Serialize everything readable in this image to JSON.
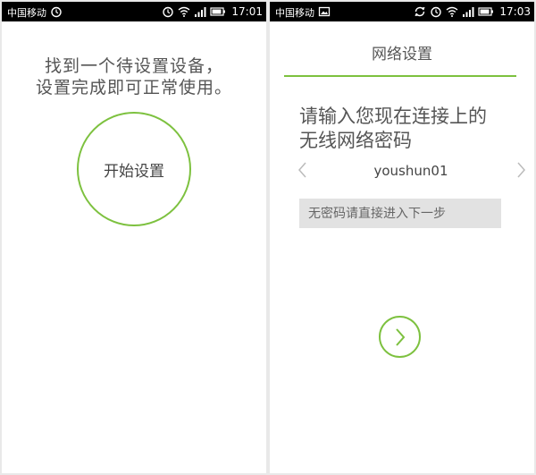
{
  "left_screen": {
    "status_bar": {
      "carrier": "中国移动",
      "time": "17:01",
      "icons": [
        "alarm-icon",
        "alarm-icon",
        "wifi-icon",
        "signal-icon",
        "battery-icon"
      ]
    },
    "intro_line1": "找到一个待设置设备，",
    "intro_line2": "设置完成即可正常使用。",
    "start_button_label": "开始设置"
  },
  "right_screen": {
    "status_bar": {
      "carrier": "中国移动",
      "time": "17:03",
      "icons": [
        "image-icon",
        "sync-icon",
        "alarm-icon",
        "wifi-icon",
        "signal-icon",
        "battery-icon"
      ]
    },
    "title": "网络设置",
    "prompt_line1": "请输入您现在连接上的",
    "prompt_line2": "无线网络密码",
    "ssid": "youshun01",
    "password_placeholder": "无密码请直接进入下一步"
  },
  "colors": {
    "accent": "#7dc13f",
    "status_bar": "#000000",
    "text": "#555555",
    "field_bg": "#e2e2e2"
  }
}
